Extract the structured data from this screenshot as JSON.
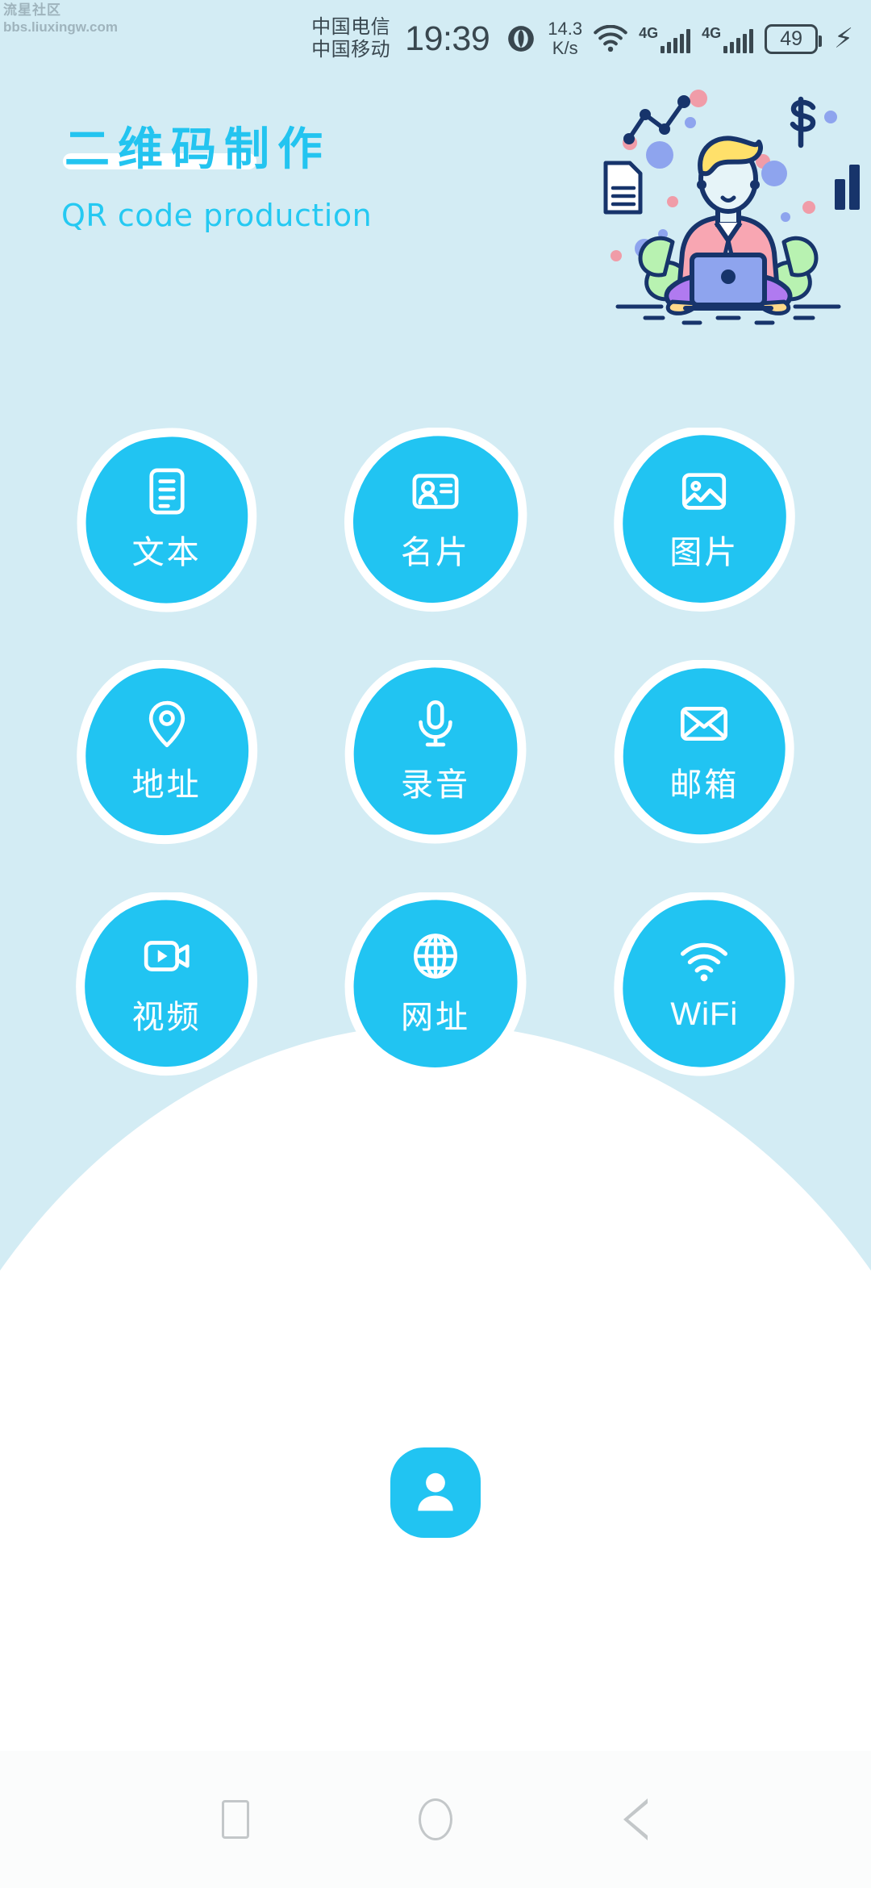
{
  "watermark": {
    "community": "流星社区",
    "url": "bbs.liuxingw.com"
  },
  "status_bar": {
    "carrier_1": "中国电信",
    "carrier_2": "中国移动",
    "time": "19:39",
    "net_speed_value": "14.3",
    "net_speed_unit": "K/s",
    "eye_icon": "eye-comfort-icon",
    "wifi_icon": "wifi-icon",
    "signal_1_label": "4G",
    "signal_2_label": "4G",
    "battery_percent": "49",
    "charging_icon": "lightning-bolt-icon"
  },
  "header": {
    "title_cn": "二维码制作",
    "title_en": "QR code production",
    "illustration": "person-with-laptop-illustration"
  },
  "grid": {
    "items": [
      {
        "label": "文本",
        "icon": "document-text-icon",
        "latin": false
      },
      {
        "label": "名片",
        "icon": "id-card-icon",
        "latin": false
      },
      {
        "label": "图片",
        "icon": "image-picture-icon",
        "latin": false
      },
      {
        "label": "地址",
        "icon": "location-pin-icon",
        "latin": false
      },
      {
        "label": "录音",
        "icon": "microphone-icon",
        "latin": false
      },
      {
        "label": "邮箱",
        "icon": "envelope-mail-icon",
        "latin": false
      },
      {
        "label": "视频",
        "icon": "video-camera-icon",
        "latin": false
      },
      {
        "label": "网址",
        "icon": "globe-web-icon",
        "latin": false
      },
      {
        "label": "WiFi",
        "icon": "wifi-signal-icon",
        "latin": true
      }
    ]
  },
  "profile": {
    "icon": "user-account-icon"
  },
  "navbar": {
    "recents_icon": "square-recents-icon",
    "home_icon": "circle-home-icon",
    "back_icon": "triangle-back-icon"
  },
  "colors": {
    "background": "#d3ecf4",
    "accent": "#21c4f2",
    "title": "#23c4f0",
    "button_fill": "#21c4f2",
    "button_border": "#ffffff",
    "status_text": "#39474f",
    "nav_icon": "#c3c7c9",
    "watermark": "#9fb4bd"
  }
}
